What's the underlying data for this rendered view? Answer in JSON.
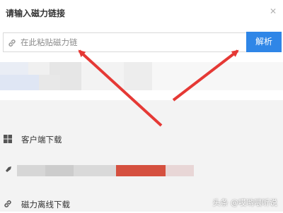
{
  "dialog": {
    "title": "请输入磁力链接",
    "close_icon": "close-icon",
    "input_placeholder": "在此粘贴磁力链",
    "input_value": "",
    "link_icon": "link-icon",
    "parse_button_label": "解析"
  },
  "menu": {
    "items": [
      {
        "label": "客户端下载",
        "icon": "windows-icon"
      },
      {
        "label": "",
        "icon": "rocket-icon"
      },
      {
        "label": "磁力离线下载",
        "icon": "link-icon"
      }
    ]
  },
  "watermark": "头条 @哎哟喂听说",
  "colors": {
    "accent": "#2f86e7",
    "annotation_arrow": "#e53935",
    "menu_bg": "#f3f3f3"
  }
}
